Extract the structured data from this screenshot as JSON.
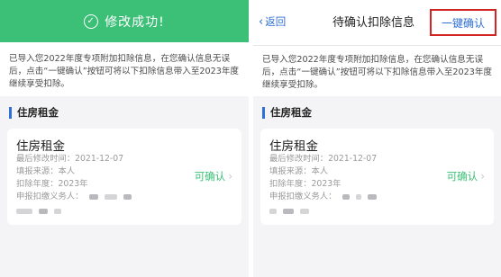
{
  "left": {
    "toast": {
      "text": "修改成功!"
    },
    "notice": "已导入您2022年度专项附加扣除信息，在您确认信息无误后，点击“一键确认”按钮可将以下扣除信息带入至2023年度继续享受扣除。",
    "section_title": "住房租金",
    "card": {
      "title": "住房租金",
      "modified": "最后修改时间：2021-12-07",
      "source": "填报来源：本人",
      "year": "扣除年度：2023年",
      "withholder_label": "申报扣缴义务人：",
      "status": "可确认"
    }
  },
  "right": {
    "nav": {
      "back": "返回",
      "title": "待确认扣除信息",
      "action": "一键确认"
    },
    "notice": "已导入您2022年度专项附加扣除信息，在您确认信息无误后，点击“一键确认”按钮可将以下扣除信息带入至2023年度继续享受扣除。",
    "section_title": "住房租金",
    "card": {
      "title": "住房租金",
      "modified": "最后修改时间：2021-12-07",
      "source": "填报来源：本人",
      "year": "扣除年度：2023年",
      "withholder_label": "申报扣缴义务人：",
      "status": "可确认"
    }
  },
  "colors": {
    "success": "#3cbf77",
    "link": "#2f6fd6",
    "highlight": "#d32424"
  },
  "icons": {
    "toast": "check-circle-icon",
    "back": "chevron-left-icon",
    "status_arrow": "chevron-right-icon"
  }
}
